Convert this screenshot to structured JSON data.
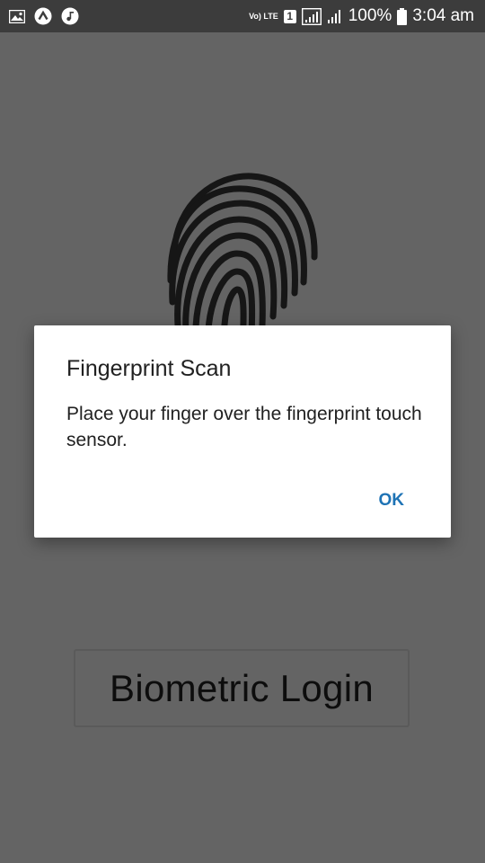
{
  "status_bar": {
    "left_icons": [
      "image-icon",
      "app-icon",
      "music-icon"
    ],
    "volte_label": "Vo) LTE",
    "sim_slot": "1",
    "battery": "100%",
    "time": "3:04 am"
  },
  "app": {
    "login_button_label": "Biometric Login"
  },
  "dialog": {
    "title": "Fingerprint Scan",
    "message": "Place your finger over the fingerprint touch sensor.",
    "ok_label": "OK"
  }
}
